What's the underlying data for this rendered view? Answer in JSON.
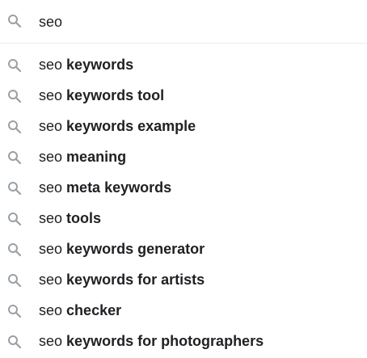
{
  "search": {
    "value": "seo",
    "icon": "search-icon"
  },
  "suggestions": [
    {
      "prefix": "seo",
      "completion": "keywords"
    },
    {
      "prefix": "seo",
      "completion": "keywords tool"
    },
    {
      "prefix": "seo",
      "completion": "keywords example"
    },
    {
      "prefix": "seo",
      "completion": "meaning"
    },
    {
      "prefix": "seo",
      "completion": "meta keywords"
    },
    {
      "prefix": "seo",
      "completion": "tools"
    },
    {
      "prefix": "seo",
      "completion": "keywords generator"
    },
    {
      "prefix": "seo",
      "completion": "keywords for artists"
    },
    {
      "prefix": "seo",
      "completion": "checker"
    },
    {
      "prefix": "seo",
      "completion": "keywords for photographers"
    }
  ],
  "colors": {
    "icon": "#9aa0a6",
    "text": "#202124",
    "divider": "#e8eaed"
  }
}
